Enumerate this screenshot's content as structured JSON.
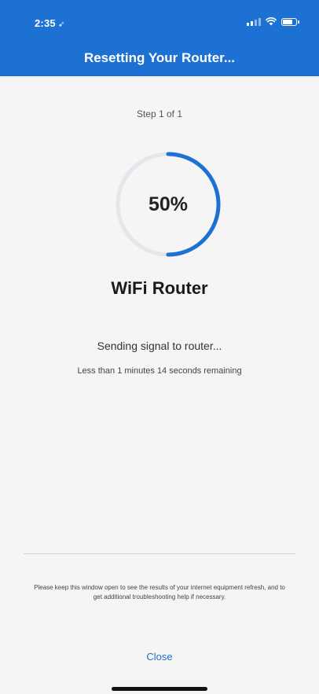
{
  "status_bar": {
    "time": "2:35",
    "location_glyph": "➶",
    "icons": [
      "signal-icon",
      "wifi-icon",
      "battery-icon"
    ]
  },
  "header": {
    "title": "Resetting Your Router..."
  },
  "main": {
    "step_label": "Step 1 of 1",
    "progress_percent": 50,
    "progress_label": "50%",
    "device_name": "WiFi Router",
    "status_text": "Sending signal to router...",
    "time_remaining": "Less than 1 minutes 14 seconds remaining"
  },
  "footer": {
    "note": "Please keep this window open to see the results of your internet equipment refresh, and to get additional troubleshooting help if necessary.",
    "close_label": "Close"
  },
  "colors": {
    "accent": "#1c71d2",
    "ring_track": "#e3e6ea",
    "background": "#f5f5f5"
  }
}
